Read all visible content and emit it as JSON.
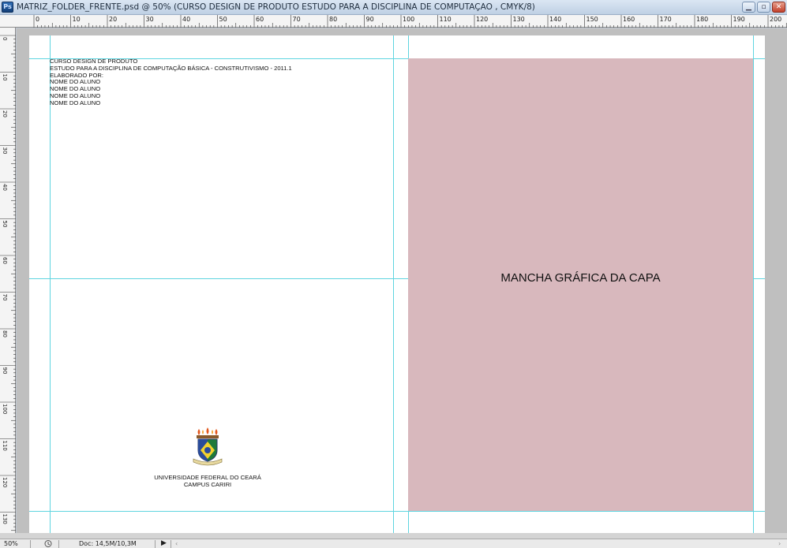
{
  "window": {
    "app_icon": "Ps",
    "title": "MATRIZ_FOLDER_FRENTE.psd @ 50% (CURSO DESIGN DE PRODUTO ESTUDO PARA A DISCIPLINA DE COMPUTAÇÃO , CMYK/8)",
    "controls": [
      "minimize-icon",
      "maximize-icon",
      "close-icon"
    ]
  },
  "ruler_top": {
    "labels": [
      "0",
      "10",
      "20",
      "30",
      "40",
      "50",
      "60",
      "70",
      "80",
      "90",
      "100",
      "110",
      "120",
      "130",
      "140",
      "150",
      "160",
      "170",
      "180",
      "190",
      "200"
    ]
  },
  "ruler_left": {
    "labels": [
      "0",
      "10",
      "20",
      "30",
      "40",
      "50",
      "60",
      "70",
      "80",
      "90",
      "100",
      "110",
      "120",
      "130"
    ]
  },
  "document": {
    "info_lines": [
      "CURSO DESIGN DE PRODUTO",
      "ESTUDO PARA A DISCIPLINA DE COMPUTAÇÃO BÁSICA - CONSTRUTIVISMO - 2011.1",
      "ELABORADO POR:",
      "NOME DO ALUNO",
      "NOME DO ALUNO",
      "NOME DO ALUNO",
      "NOME DO ALUNO"
    ],
    "cover_label": "MANCHA GRÁFICA DA CAPA",
    "university": "UNIVERSIDADE FEDERAL DO CEARÁ",
    "campus": "CAMPUS CARIRI",
    "cover_color": "#d8b8bd",
    "guide_color": "#5fd5e0"
  },
  "statusbar": {
    "zoom": "50%",
    "doc_size": "Doc: 14,5M/10,3M"
  }
}
